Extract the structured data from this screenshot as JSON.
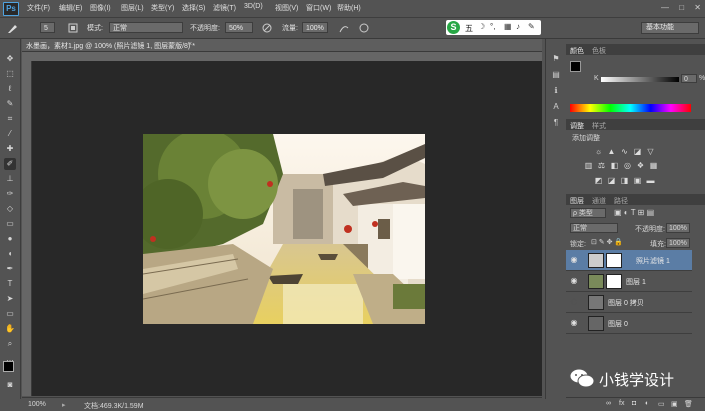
{
  "app": {
    "logo": "Ps"
  },
  "menu": [
    "文件(F)",
    "编辑(E)",
    "图像(I)",
    "图层(L)",
    "类型(Y)",
    "选择(S)",
    "滤镜(T)",
    "3D(D)",
    "视图(V)",
    "窗口(W)",
    "帮助(H)"
  ],
  "window_controls": [
    "—",
    "□",
    "✕"
  ],
  "options": {
    "brush_size": "5",
    "mode_label": "模式:",
    "mode_value": "正常",
    "opacity_label": "不透明度:",
    "opacity_value": "50%",
    "flow_label": "流量:",
    "flow_value": "100%"
  },
  "ime": {
    "logo": "S",
    "label": "五"
  },
  "workspace": "基本功能",
  "document": {
    "tab_label": "水墨画，素材1.jpg @ 100% (照片滤镜 1, 图层蒙版/8) *",
    "close": "×",
    "status_zoom": "100%",
    "status_doc": "文档:469.3K/1.59M"
  },
  "panels": {
    "color_tabs": [
      "颜色",
      "色板"
    ],
    "k_label": "K",
    "k_value": "0",
    "k_unit": "%",
    "adjust_tabs": [
      "调整",
      "样式"
    ],
    "adjust_title": "添加调整",
    "layers_tabs": [
      "图层",
      "通道",
      "路径"
    ],
    "filter_kind": "ρ 类型",
    "blend_mode": "正常",
    "opacity_label": "不透明度:",
    "opacity_value": "100%",
    "lock_label": "锁定:",
    "fill_label": "填充:",
    "fill_value": "100%"
  },
  "layers": [
    {
      "name": "照片滤镜 1",
      "selected": true
    },
    {
      "name": "图层 1",
      "selected": false
    },
    {
      "name": "图层 0 拷贝",
      "selected": false
    },
    {
      "name": "图层 0",
      "selected": false
    }
  ],
  "layer_footer_icons": [
    "∞",
    "fx",
    "◘",
    "◐",
    "▭",
    "▣",
    "🗑"
  ],
  "watermark": {
    "text": "小钱学设计"
  },
  "colors": {
    "bg": "#535353",
    "canvas": "#282828",
    "selected_layer": "#5b7da5",
    "accent": "#28a745"
  }
}
